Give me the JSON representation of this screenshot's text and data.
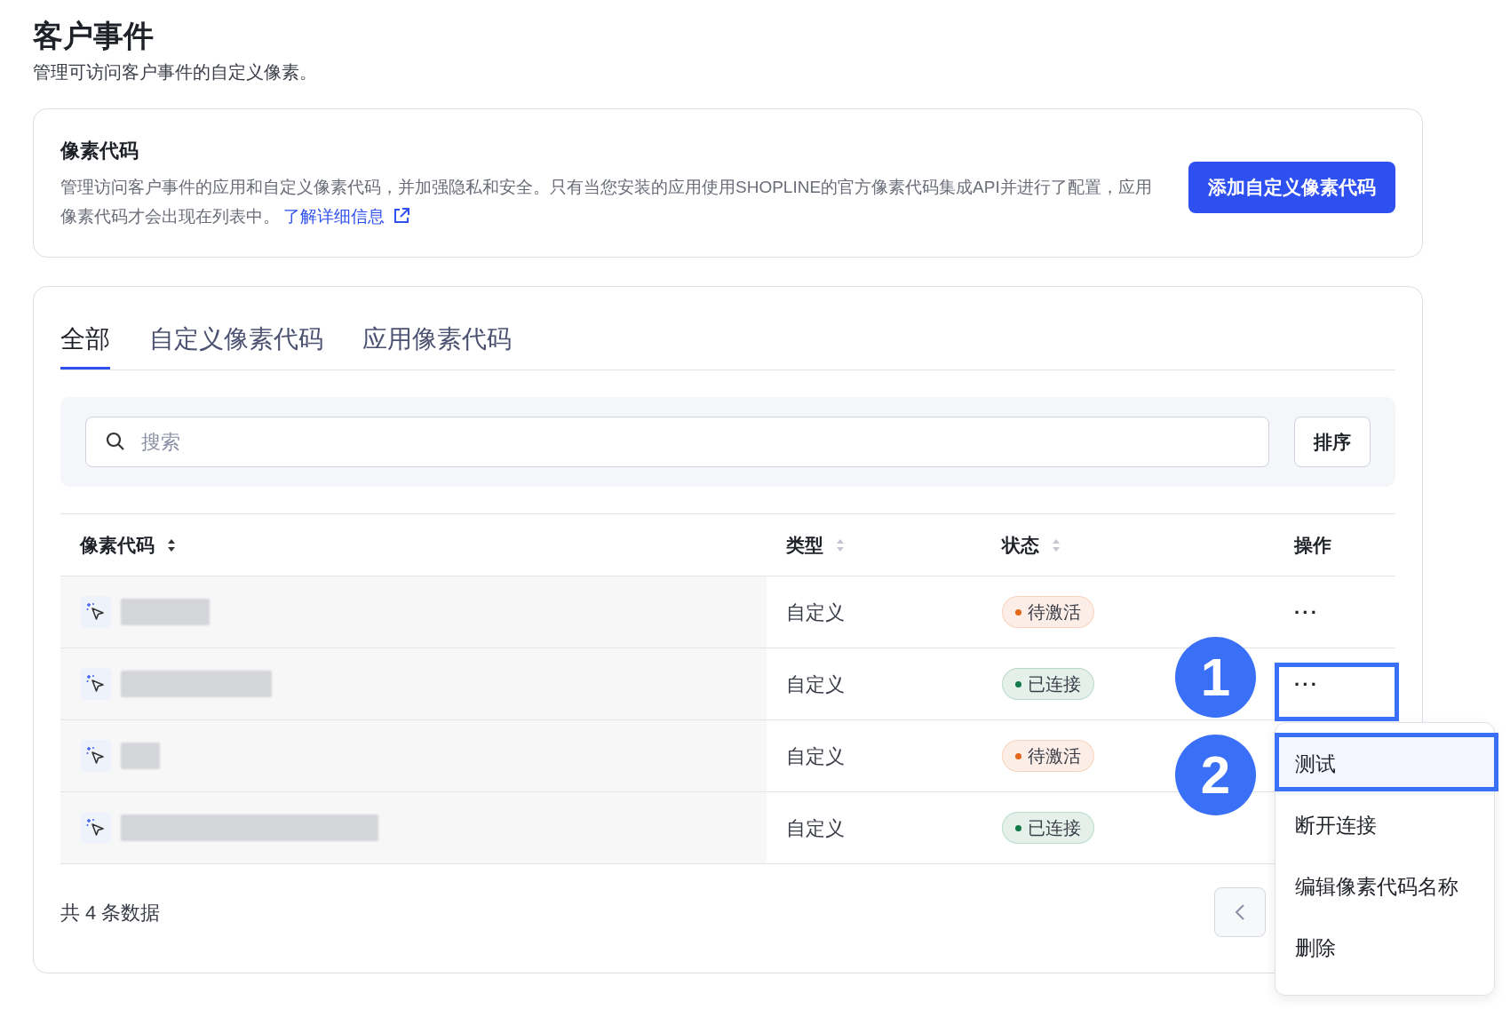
{
  "page": {
    "title": "客户事件",
    "subtitle": "管理可访问客户事件的自定义像素。"
  },
  "pixel_card": {
    "title": "像素代码",
    "description": "管理访问客户事件的应用和自定义像素代码，并加强隐私和安全。只有当您安装的应用使用SHOPLINE的官方像素代码集成API并进行了配置，应用像素代码才会出现在列表中。",
    "link": "了解详细信息",
    "button": "添加自定义像素代码"
  },
  "tabs": [
    {
      "label": "全部",
      "selected": true
    },
    {
      "label": "自定义像素代码",
      "selected": false
    },
    {
      "label": "应用像素代码",
      "selected": false
    }
  ],
  "search": {
    "placeholder": "搜索"
  },
  "sort_button": "排序",
  "table": {
    "columns": [
      {
        "label": "像素代码",
        "sortable": true
      },
      {
        "label": "类型",
        "sortable": true
      },
      {
        "label": "状态",
        "sortable": true
      },
      {
        "label": "操作",
        "sortable": false
      }
    ],
    "rows": [
      {
        "type": "自定义",
        "status": "待激活",
        "color": "#e4681b",
        "actions": "···"
      },
      {
        "type": "自定义",
        "status": "已连接",
        "color": "#0f7a48",
        "actions": "···"
      },
      {
        "type": "自定义",
        "status": "待激活",
        "color": "#e4681b"
      },
      {
        "type": "自定义",
        "status": "已连接",
        "color": "#0f7a48"
      }
    ]
  },
  "footer": {
    "total": "共 4 条数据"
  },
  "menu": {
    "items": [
      {
        "label": "测试",
        "highlighted": true
      },
      {
        "label": "断开连接",
        "highlighted": false
      },
      {
        "label": "编辑像素代码名称",
        "highlighted": false
      },
      {
        "label": "删除",
        "highlighted": false
      }
    ]
  },
  "annotations": [
    {
      "number": "1"
    },
    {
      "number": "2"
    }
  ]
}
